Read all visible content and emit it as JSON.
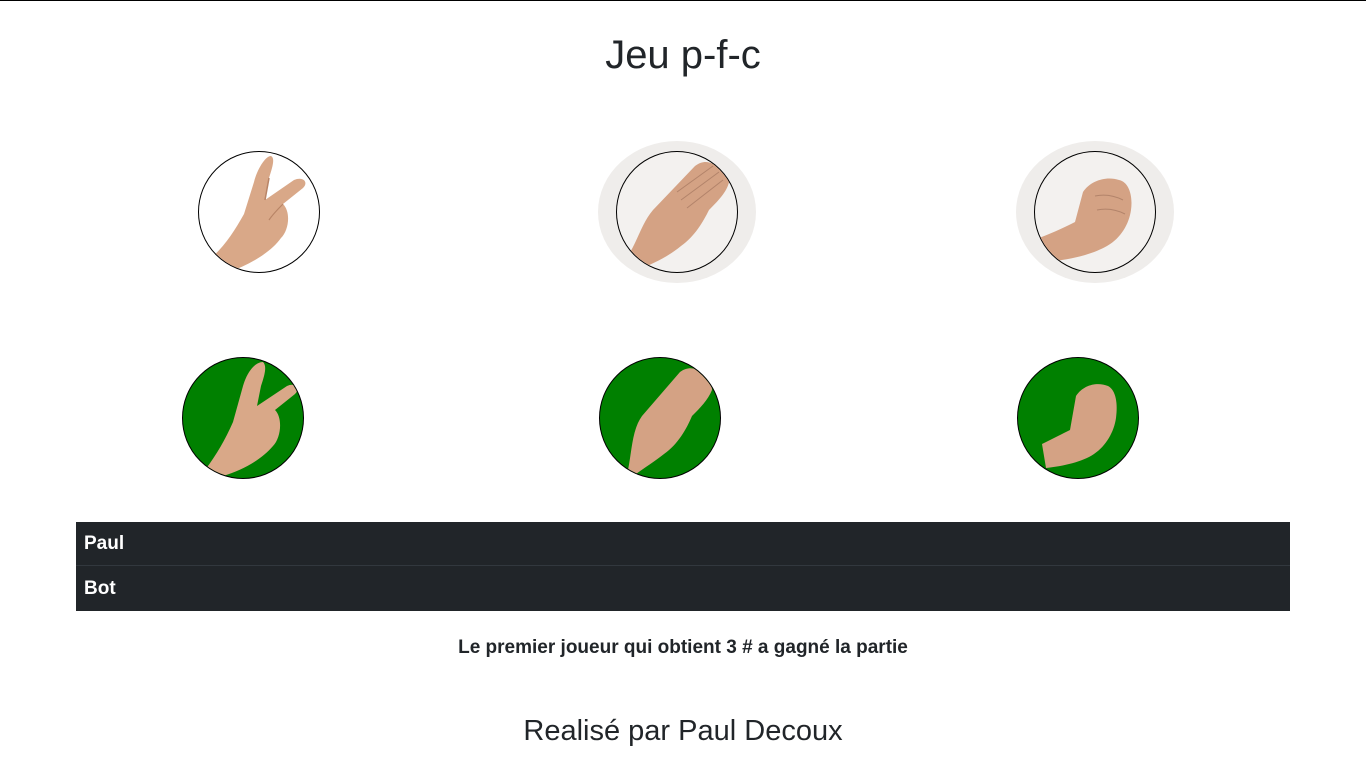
{
  "header": {
    "title": "Jeu p-f-c"
  },
  "player_choices": [
    {
      "name": "ciseaux",
      "icon": "scissors-hand-icon",
      "selected": false
    },
    {
      "name": "feuille",
      "icon": "paper-hand-icon",
      "selected": true
    },
    {
      "name": "pierre",
      "icon": "rock-hand-icon",
      "selected": true
    }
  ],
  "bot_choices": [
    {
      "name": "ciseaux",
      "icon": "scissors-hand-icon"
    },
    {
      "name": "feuille",
      "icon": "paper-hand-icon"
    },
    {
      "name": "pierre",
      "icon": "rock-hand-icon"
    }
  ],
  "scoreboard": {
    "rows": [
      {
        "name": "Paul",
        "score": ""
      },
      {
        "name": "Bot",
        "score": ""
      }
    ]
  },
  "rule_text": "Le premier joueur qui obtient 3 # a gagné la partie",
  "footer_text": "Realisé par Paul Decoux",
  "colors": {
    "bot_circle": "#008000",
    "table_bg": "#212529",
    "skin": "#d9a888"
  }
}
